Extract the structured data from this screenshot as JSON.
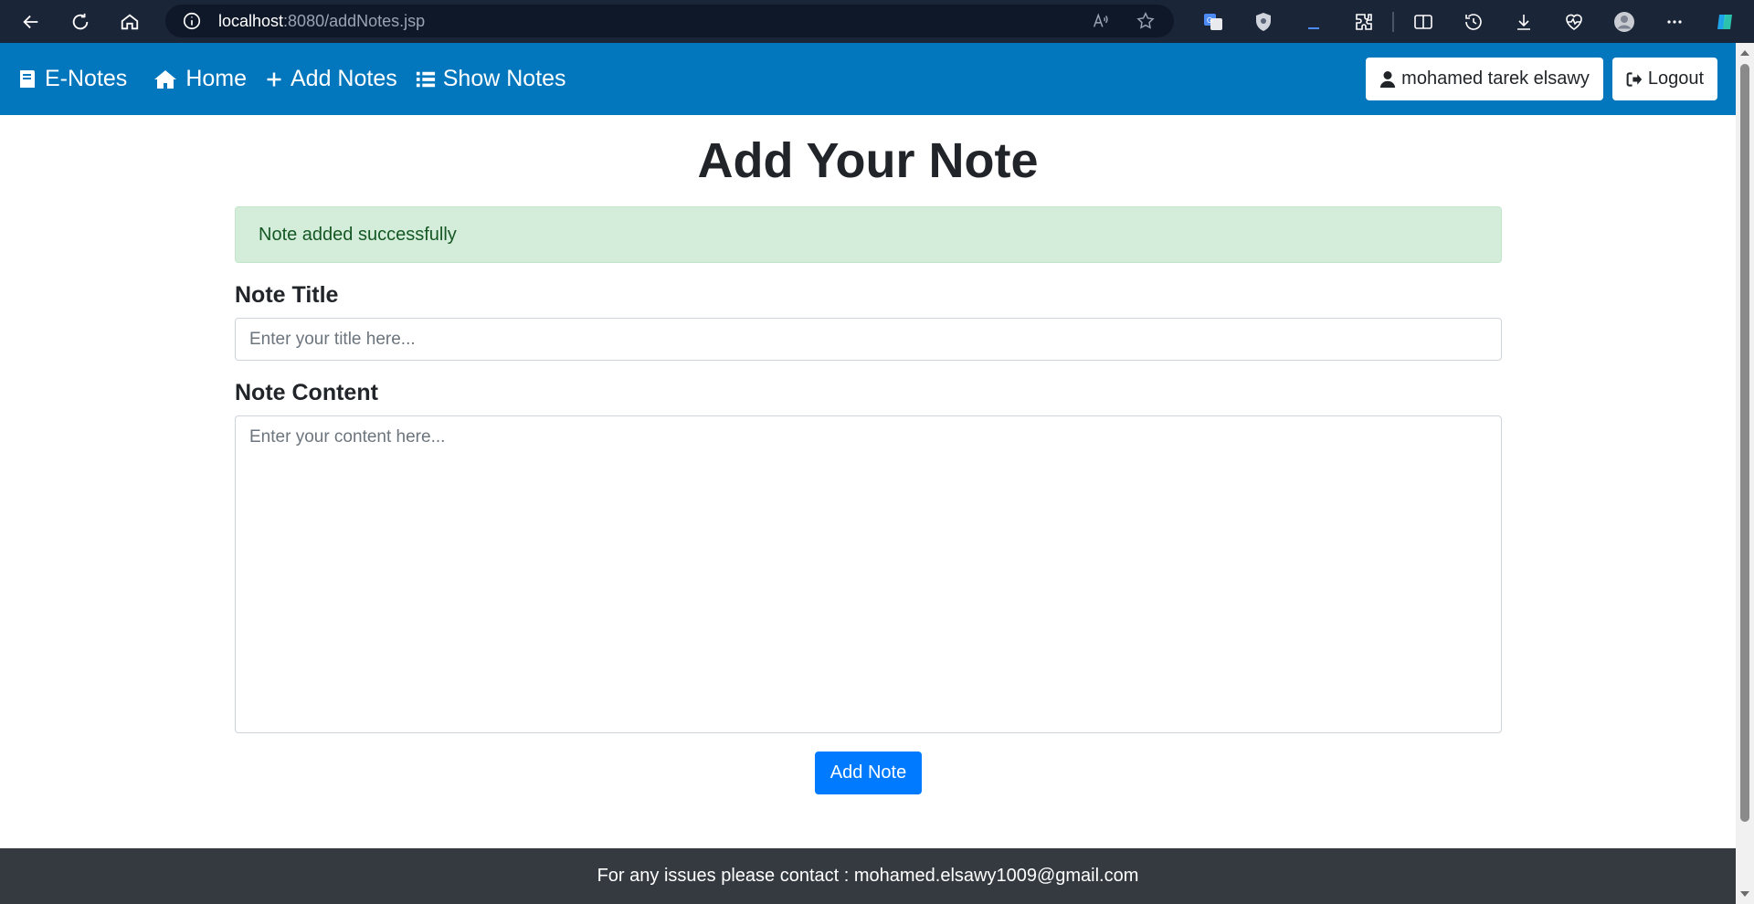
{
  "browser": {
    "url_host": "localhost",
    "url_rest": ":8080/addNotes.jsp",
    "icons": [
      "back-icon",
      "refresh-icon",
      "home-icon",
      "info-icon",
      "read-aloud-icon",
      "favorite-star-icon",
      "translate-icon",
      "shield-icon",
      "downloads-progress-icon",
      "extensions-icon",
      "split-screen-icon",
      "history-icon",
      "download-icon",
      "performance-icon",
      "profile-avatar-icon",
      "more-icon",
      "copilot-icon"
    ]
  },
  "navbar": {
    "brand": "E-Notes",
    "home": "Home",
    "add_notes": "Add Notes",
    "show_notes": "Show Notes",
    "user": "mohamed tarek elsawy",
    "logout": "Logout"
  },
  "page": {
    "title": "Add Your Note",
    "alert": "Note added successfully",
    "note_title_label": "Note Title",
    "note_title_placeholder": "Enter your title here...",
    "note_content_label": "Note Content",
    "note_content_placeholder": "Enter your content here...",
    "submit": "Add Note"
  },
  "footer": {
    "text": "For any issues please contact : mohamed.elsawy1009@gmail.com"
  },
  "colors": {
    "navbar": "#0277bd",
    "alert_bg": "#d4edda",
    "alert_text": "#155724",
    "button": "#007bff",
    "footer": "#343a40",
    "browser_bar": "#1b2538"
  }
}
